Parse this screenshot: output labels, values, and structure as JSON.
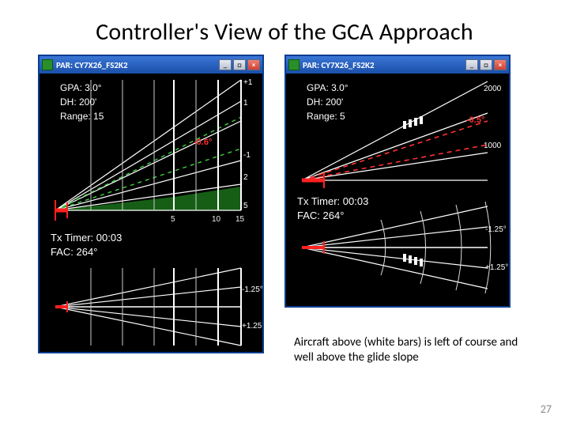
{
  "title": "Controller's View of the GCA Approach",
  "window_title": "PAR: CY7X26_FS2K2",
  "left": {
    "gpa": "GPA: 3.0°",
    "dh": "DH: 200'",
    "range": "Range: 15",
    "tx_timer": "Tx Timer: 00:03",
    "fac": "FAC: 264°",
    "elev_ticks": [
      "+1",
      "1",
      "-1",
      "2",
      "5"
    ],
    "elev_dev": "-0.6°",
    "range_ticks": [
      "5",
      "10",
      "15"
    ],
    "az_ticks": [
      "-1.25°",
      "+1.25°"
    ]
  },
  "right": {
    "gpa": "GPA: 3.0°",
    "dh": "DH: 200'",
    "range": "Range: 5",
    "tx_timer": "Tx Timer: 00:03",
    "fac": "FAC: 264°",
    "alt_ticks": [
      "2000",
      "1000"
    ],
    "elev_dev": "-0.5°",
    "az_ticks": [
      "-1.25°",
      "+1.25°"
    ]
  },
  "caption": "Aircraft above (white bars) is left of course and well above the glide slope",
  "page": "27"
}
